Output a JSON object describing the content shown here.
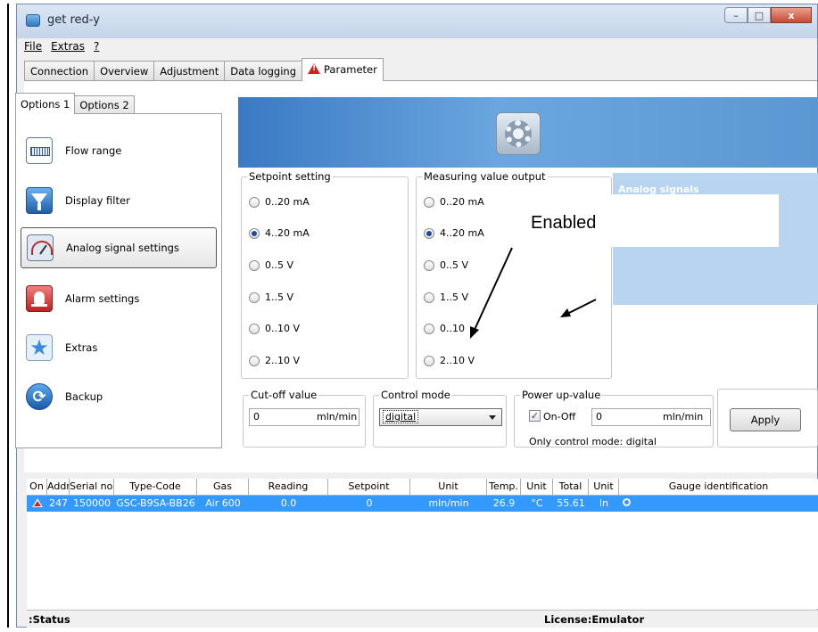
{
  "window": {
    "title": "get red-y",
    "ghost_title": "",
    "buttons": {
      "minimize": "–",
      "maximize": "□",
      "close": "x"
    }
  },
  "menu": {
    "items": [
      "File",
      "Extras",
      "?"
    ]
  },
  "main_tabs": [
    "Connection",
    "Overview",
    "Adjustment",
    "Data logging",
    "Parameter"
  ],
  "option_tabs": [
    "Options 1",
    "Options 2"
  ],
  "nav": {
    "items": [
      {
        "label": "Flow range",
        "icon": "ruler-icon"
      },
      {
        "label": "Display filter",
        "icon": "filter-icon"
      },
      {
        "label": "Analog signal settings",
        "icon": "gauge-icon"
      },
      {
        "label": "Alarm settings",
        "icon": "alarm-bell-icon"
      },
      {
        "label": "Extras",
        "icon": "star-icon"
      },
      {
        "label": "Backup",
        "icon": "backup-icon"
      }
    ],
    "active": "Analog signal settings"
  },
  "setpoint": {
    "title": "Setpoint setting",
    "options": [
      "0..20 mA",
      "4..20 mA",
      "0..5  V",
      "1..5 V",
      "0..10  V",
      "2..10 V"
    ],
    "selected": "4..20 mA"
  },
  "measuring": {
    "title": "Measuring value output",
    "options": [
      "0..20 mA",
      "4..20 mA",
      "0..5  V",
      "1..5 V",
      "0..10",
      "2..10 V"
    ],
    "selected": "4..20 mA"
  },
  "analog": {
    "title": "Analog signals"
  },
  "callout": {
    "text": "Enabled"
  },
  "cutoff": {
    "title": "Cut-off value",
    "value": "0",
    "unit": "mln/min"
  },
  "control": {
    "title": "Control mode",
    "value": "digital"
  },
  "powerup": {
    "title": "Power up-value",
    "checkbox_label": "On-Off",
    "checkbox_checked": true,
    "value": "0",
    "unit": "mln/min",
    "note": "Only control mode: digital"
  },
  "apply_label": "Apply",
  "table": {
    "headers": [
      "On",
      "Addr.",
      "Serial no.",
      "Type-Code",
      "Gas",
      "Reading",
      "Setpoint",
      "Unit",
      "Temp.",
      "Unit",
      "Total",
      "Unit",
      "Gauge identification"
    ],
    "row": [
      "",
      "247",
      "150000",
      "GSC-B9SA-BB26",
      "Air 600",
      "0.0",
      "0",
      "mln/min",
      "26.9",
      "°C",
      "55.61",
      "ln",
      ""
    ]
  },
  "status": {
    "left": ":Status",
    "right": "License:Emulator"
  },
  "colors": {
    "selection": "#3399ff",
    "banner": "#3a7ac4",
    "analog_box": "#b8d4f0",
    "alarm": "#d42222"
  }
}
